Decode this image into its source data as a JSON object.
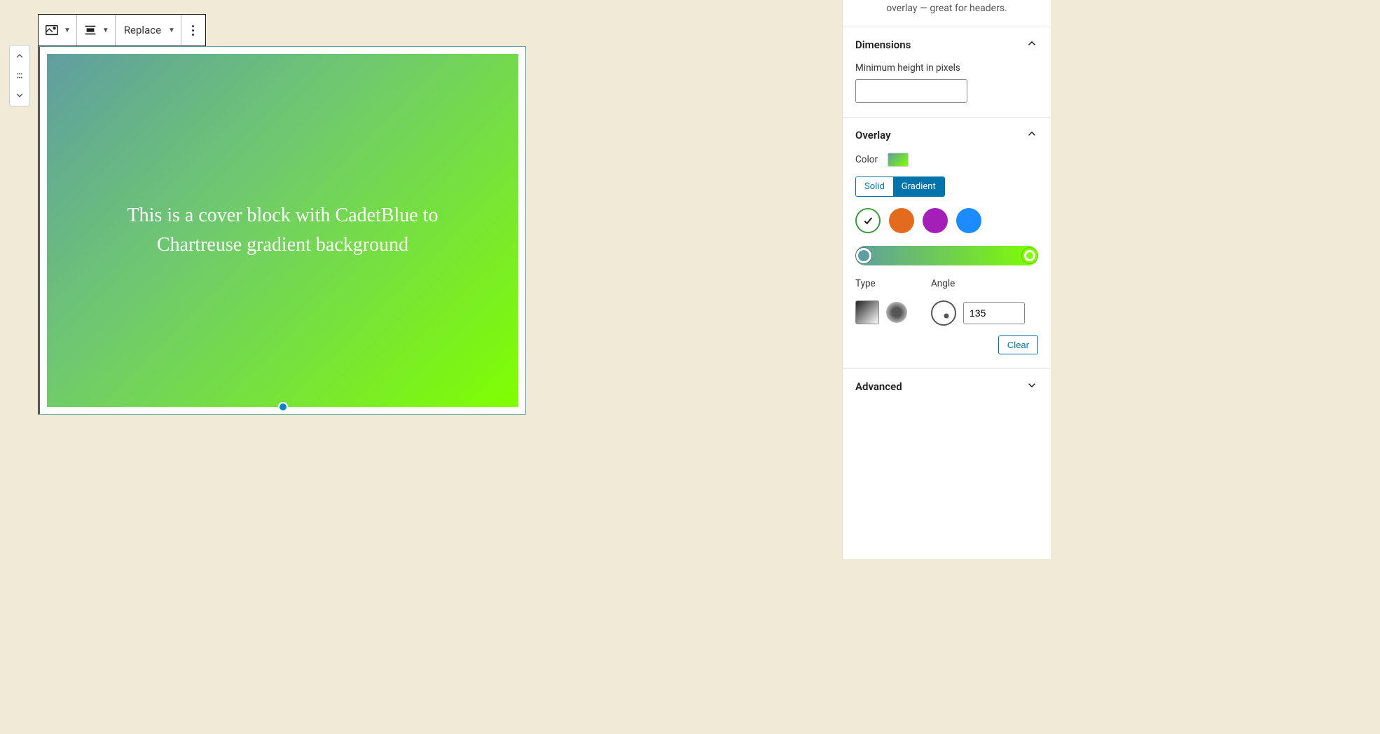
{
  "description_tail": "overlay — great for headers.",
  "toolbar": {
    "replace_label": "Replace"
  },
  "cover": {
    "text": "This is a cover block with CadetBlue to Chartreuse gradient background"
  },
  "panels": {
    "dimensions": {
      "title": "Dimensions",
      "min_height_label": "Minimum height in pixels",
      "min_height_value": ""
    },
    "overlay": {
      "title": "Overlay",
      "color_label": "Color",
      "solid_label": "Solid",
      "gradient_label": "Gradient",
      "type_label": "Type",
      "angle_label": "Angle",
      "angle_value": "135",
      "clear_label": "Clear",
      "presets": [
        {
          "name": "custom-selected",
          "color": "#ffffff"
        },
        {
          "name": "orange",
          "color": "#e36b1e"
        },
        {
          "name": "purple",
          "color": "#a31fb8"
        },
        {
          "name": "blue",
          "color": "#1a8cff"
        }
      ]
    },
    "advanced": {
      "title": "Advanced"
    }
  }
}
